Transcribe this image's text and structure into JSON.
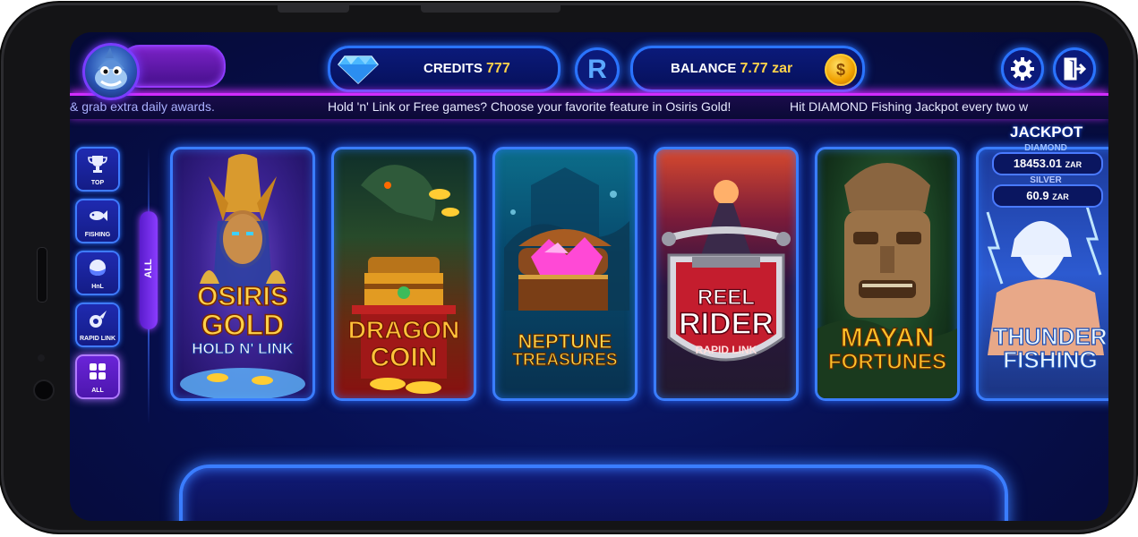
{
  "header": {
    "credits_label": "CREDITS",
    "credits_value": "777",
    "r_badge": "R",
    "balance_label": "BALANCE",
    "balance_value": "7.77 zar",
    "coin_symbol": "$"
  },
  "ticker": {
    "items": [
      "& grab extra daily awards.",
      "Hold 'n' Link or Free games? Choose your favorite feature in Osiris Gold!",
      "Hit DIAMOND Fishing Jackpot every two w"
    ]
  },
  "sidebar": {
    "items": [
      {
        "label": "TOP",
        "icon": "trophy-icon"
      },
      {
        "label": "FISHING",
        "icon": "fish-icon"
      },
      {
        "label": "HnL",
        "icon": "orb-icon"
      },
      {
        "label": "RAPID LINK",
        "icon": "rapid-link-icon"
      },
      {
        "label": "ALL",
        "icon": "grid-icon"
      }
    ],
    "active_tab": "ALL"
  },
  "games": [
    {
      "title_line1": "OSIRIS",
      "title_line2": "GOLD",
      "subtitle": "HOLD N' LINK"
    },
    {
      "title_line1": "DRAGON",
      "title_line2": "COIN"
    },
    {
      "title_line1": "NEPTUNE",
      "title_line2": "TREASURES"
    },
    {
      "title_line1": "REEL",
      "title_line2": "RIDER",
      "subtitle": "RAPID LINK"
    },
    {
      "title_line1": "MAYAN",
      "title_line2": "FORTUNES"
    },
    {
      "title_line1": "THUNDER",
      "title_line2": "FISHING"
    }
  ],
  "jackpot": {
    "title": "JACKPOT",
    "diamond_label": "DIAMOND",
    "diamond_value": "18453.01",
    "silver_label": "SILVER",
    "silver_value": "60.9",
    "currency": "ZAR"
  },
  "colors": {
    "accent_blue": "#2a74ff",
    "accent_purple": "#9b44ff",
    "gold": "#ffd44a"
  }
}
